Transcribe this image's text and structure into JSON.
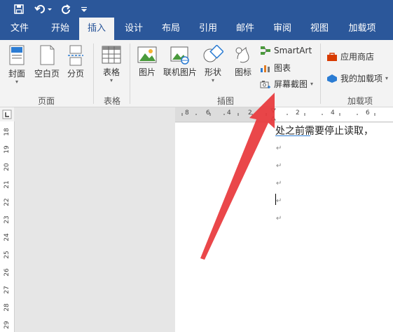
{
  "quick_access": {
    "save_icon": "save-icon",
    "undo_icon": "undo-icon",
    "redo_icon": "redo-icon",
    "customize_icon": "customize-icon"
  },
  "tabs": [
    "文件",
    "开始",
    "插入",
    "设计",
    "布局",
    "引用",
    "邮件",
    "审阅",
    "视图",
    "加载项"
  ],
  "active_tab": "插入",
  "ribbon": {
    "pages": {
      "cover": "封面",
      "blank": "空白页",
      "break": "分页",
      "group": "页面"
    },
    "tables": {
      "table": "表格",
      "group": "表格"
    },
    "illustrations": {
      "picture": "图片",
      "online_picture": "联机图片",
      "shapes": "形状",
      "icons": "图标",
      "smartart": "SmartArt",
      "chart": "图表",
      "screenshot": "屏幕截图",
      "group": "插图"
    },
    "addins": {
      "store": "应用商店",
      "my_addins": "我的加载项",
      "group": "加载项"
    }
  },
  "ruler": {
    "top_ticks": [
      "8",
      "6",
      "4",
      "2",
      "2",
      "4",
      "6"
    ],
    "left_ticks": [
      "18",
      "19",
      "20",
      "21",
      "22",
      "23",
      "24",
      "25",
      "26",
      "27",
      "28",
      "29"
    ]
  },
  "document": {
    "first_line": "处之前需要停止读取，",
    "paragraph_mark": "↵"
  },
  "colors": {
    "brand": "#2b579a",
    "arrow": "#e8373b"
  }
}
